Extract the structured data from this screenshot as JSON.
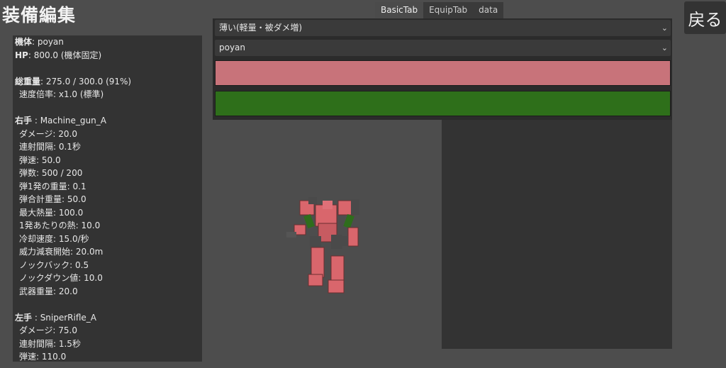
{
  "header": {
    "title": "装備編集",
    "back_label": "戻る"
  },
  "tabs": [
    {
      "label": "BasicTab",
      "active": true
    },
    {
      "label": "EquipTab",
      "active": false
    },
    {
      "label": "data",
      "active": false
    }
  ],
  "selects": {
    "top_value": "薄い(軽量・被ダメ増)",
    "frame_value": "poyan"
  },
  "colors": {
    "bar_red": "#c8737a",
    "bar_green": "#2e6f1a"
  },
  "stats": [
    {
      "key": "機体",
      "value": ": poyan",
      "bold": true,
      "indent": false
    },
    {
      "key": "HP",
      "value": ": 800.0 (機体固定)",
      "bold": true,
      "indent": false
    },
    {
      "key": "",
      "value": "",
      "bold": false,
      "indent": false
    },
    {
      "key": "総重量",
      "value": ": 275.0 / 300.0 (91%)",
      "bold": true,
      "indent": false
    },
    {
      "key": "",
      "value": "速度倍率: x1.0 (標準)",
      "bold": false,
      "indent": true
    },
    {
      "key": "",
      "value": "",
      "bold": false,
      "indent": false
    },
    {
      "key": "右手",
      "value": " : Machine_gun_A",
      "bold": true,
      "indent": false
    },
    {
      "key": "",
      "value": "ダメージ: 20.0",
      "bold": false,
      "indent": true
    },
    {
      "key": "",
      "value": "連射間隔: 0.1秒",
      "bold": false,
      "indent": true
    },
    {
      "key": "",
      "value": "弾速: 50.0",
      "bold": false,
      "indent": true
    },
    {
      "key": "",
      "value": "弾数: 500 / 200",
      "bold": false,
      "indent": true
    },
    {
      "key": "",
      "value": "弾1発の重量: 0.1",
      "bold": false,
      "indent": true
    },
    {
      "key": "",
      "value": "弾合計重量: 50.0",
      "bold": false,
      "indent": true
    },
    {
      "key": "",
      "value": "最大熱量: 100.0",
      "bold": false,
      "indent": true
    },
    {
      "key": "",
      "value": "1発あたりの熱: 10.0",
      "bold": false,
      "indent": true
    },
    {
      "key": "",
      "value": "冷却速度: 15.0/秒",
      "bold": false,
      "indent": true
    },
    {
      "key": "",
      "value": "威力減衰開始: 20.0m",
      "bold": false,
      "indent": true
    },
    {
      "key": "",
      "value": "ノックバック: 0.5",
      "bold": false,
      "indent": true
    },
    {
      "key": "",
      "value": "ノックダウン値: 10.0",
      "bold": false,
      "indent": true
    },
    {
      "key": "",
      "value": "武器重量: 20.0",
      "bold": false,
      "indent": true
    },
    {
      "key": "",
      "value": "",
      "bold": false,
      "indent": false
    },
    {
      "key": "左手",
      "value": " : SniperRifle_A",
      "bold": true,
      "indent": false
    },
    {
      "key": "",
      "value": "ダメージ: 75.0",
      "bold": false,
      "indent": true
    },
    {
      "key": "",
      "value": "連射間隔: 1.5秒",
      "bold": false,
      "indent": true
    },
    {
      "key": "",
      "value": "弾速: 110.0",
      "bold": false,
      "indent": true
    }
  ]
}
